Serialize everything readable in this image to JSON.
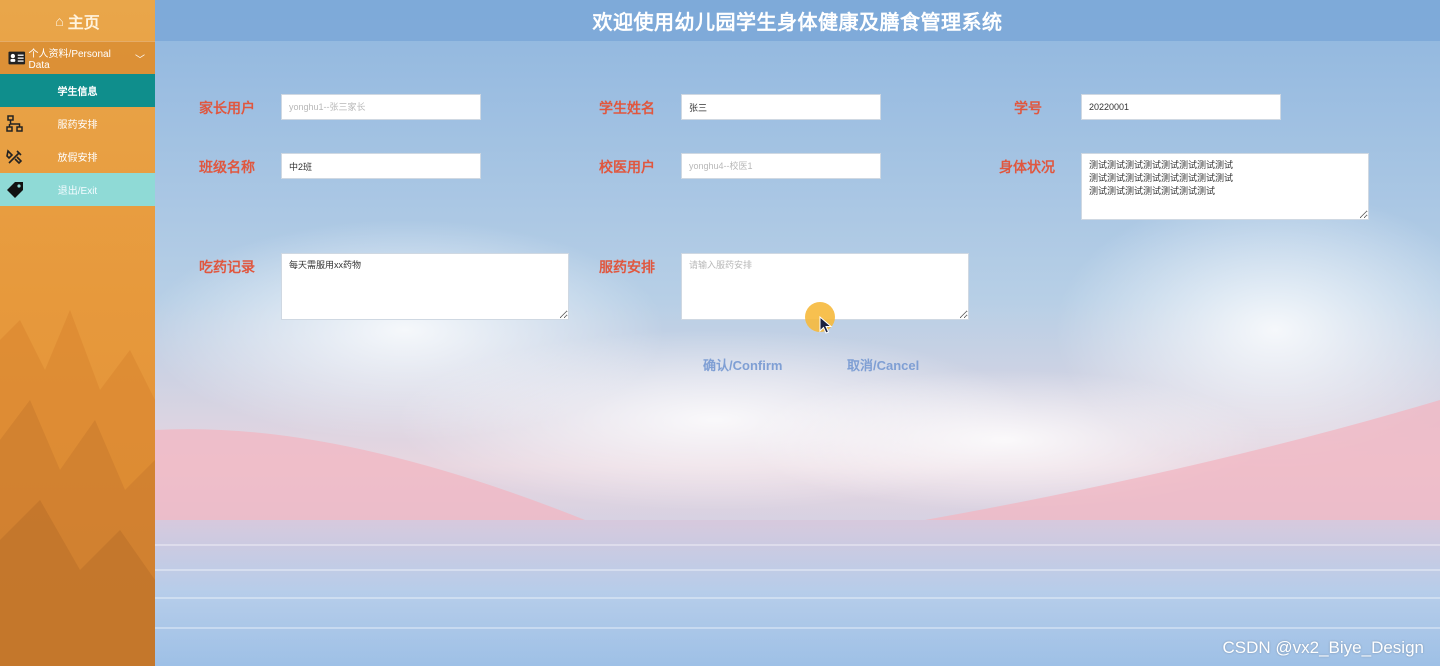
{
  "sidebar": {
    "home_label": "主页",
    "group_label": "个人资料/Personal Data",
    "items": [
      {
        "label": "学生信息",
        "icon": "none",
        "active": true
      },
      {
        "label": "服药安排",
        "icon": "org-chart-icon"
      },
      {
        "label": "放假安排",
        "icon": "tools-icon"
      },
      {
        "label": "退出/Exit",
        "icon": "tag-icon"
      }
    ]
  },
  "header": {
    "title": "欢迎使用幼儿园学生身体健康及膳食管理系统"
  },
  "form": {
    "parent_user": {
      "label": "家长用户",
      "value": "",
      "placeholder": "yonghu1--张三家长"
    },
    "student_name": {
      "label": "学生姓名",
      "value": "张三",
      "placeholder": ""
    },
    "student_no": {
      "label": "学号",
      "value": "20220001",
      "placeholder": ""
    },
    "class_name": {
      "label": "班级名称",
      "value": "中2班",
      "placeholder": ""
    },
    "doctor_user": {
      "label": "校医用户",
      "value": "",
      "placeholder": "yonghu4--校医1"
    },
    "health": {
      "label": "身体状况",
      "value": "测试测试测试测试测试测试测试测试\n测试测试测试测试测试测试测试测试\n测试测试测试测试测试测试测试"
    },
    "medicine_record": {
      "label": "吃药记录",
      "value": "每天需服用xx药物"
    },
    "medicine_plan": {
      "label": "服药安排",
      "value": "",
      "placeholder": "请输入服药安排"
    }
  },
  "buttons": {
    "confirm": "确认/Confirm",
    "cancel": "取消/Cancel"
  },
  "watermark": "CSDN @vx2_Biye_Design",
  "colors": {
    "sidebar": "#e9a64a",
    "active_item": "#0f8e8c",
    "exit_item": "#8fdad6",
    "label": "#e0573f",
    "button": "#7f9fd4"
  }
}
